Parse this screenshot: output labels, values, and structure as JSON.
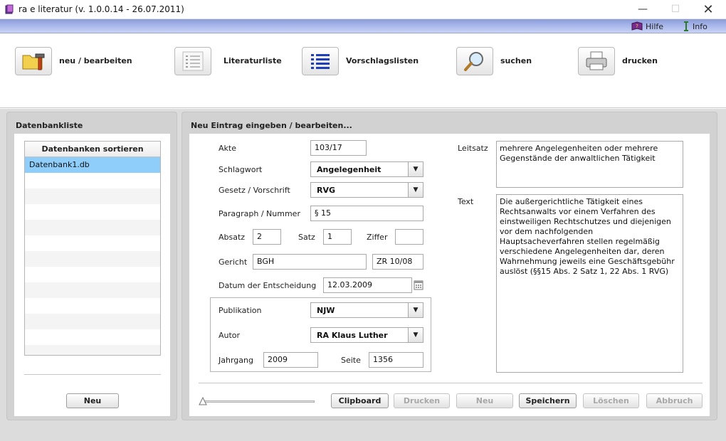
{
  "window": {
    "title": "ra e literatur (v. 1.0.0.14 - 26.07.2011)"
  },
  "menu": {
    "hilfe": "Hilfe",
    "info": "Info"
  },
  "toolbar": {
    "new_edit": "neu / bearbeiten",
    "literature_list": "Literaturliste",
    "suggestion_lists": "Vorschlagslisten",
    "search": "suchen",
    "print": "drucken"
  },
  "left_panel": {
    "title": "Datenbankliste",
    "list_header": "Datenbanken sortieren",
    "items": [
      "Datenbank1.db"
    ],
    "new_button": "Neu"
  },
  "right_panel": {
    "title": "Neu Eintrag eingeben / bearbeiten...",
    "fields": {
      "akte_label": "Akte",
      "akte_value": "103/17",
      "schlagwort_label": "Schlagwort",
      "schlagwort_value": "Angelegenheit",
      "gesetz_label": "Gesetz / Vorschrift",
      "gesetz_value": "RVG",
      "paragraph_label": "Paragraph / Nummer",
      "paragraph_value": "§ 15",
      "absatz_label": "Absatz",
      "absatz_value": "2",
      "satz_label": "Satz",
      "satz_value": "1",
      "ziffer_label": "Ziffer",
      "ziffer_value": "",
      "gericht_label": "Gericht",
      "gericht_value": "BGH",
      "aktenzeichen_value": "ZR 10/08",
      "datum_label": "Datum der Entscheidung",
      "datum_value": "12.03.2009",
      "publikation_label": "Publikation",
      "publikation_value": "NJW",
      "autor_label": "Autor",
      "autor_value": "RA Klaus Luther",
      "jahrgang_label": "Jahrgang",
      "jahrgang_value": "2009",
      "seite_label": "Seite",
      "seite_value": "1356",
      "leitsatz_label": "Leitsatz",
      "leitsatz_value": "mehrere Angelegenheiten oder mehrere Gegenstände der anwaltlichen Tätigkeit",
      "text_label": "Text",
      "text_value": "Die außergerichtliche Tätigkeit eines Rechtsanwalts vor einem Verfahren des einstweiligen Rechtschutzes und diejenigen vor dem nachfolgenden Hauptsacheverfahren stellen regelmäßig verschiedene Angelegenheiten dar, deren Wahrnehmung jeweils eine Geschäftsgebühr auslöst (§§15 Abs. 2 Satz 1, 22 Abs. 1 RVG)"
    },
    "buttons": {
      "clipboard": "Clipboard",
      "drucken": "Drucken",
      "neu": "Neu",
      "speichern": "Speichern",
      "loeschen": "Löschen",
      "abbruch": "Abbruch"
    }
  },
  "colors": {
    "menu_gradient": "#a7b6ea",
    "selection": "#8fcdfa"
  }
}
